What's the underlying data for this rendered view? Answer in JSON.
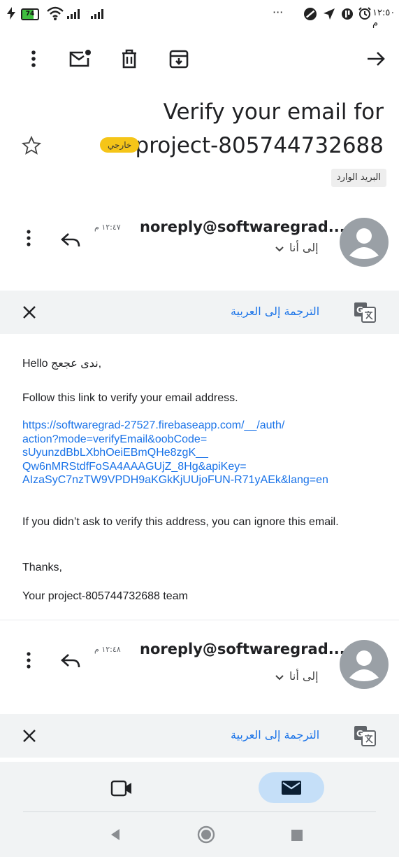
{
  "status_bar": {
    "battery": "74",
    "time": "١٢:٥٠ م",
    "dots": "···"
  },
  "toolbar": {
    "icons": [
      "more-vert-icon",
      "mark-unread-icon",
      "delete-icon",
      "archive-icon",
      "forward-arrow-icon"
    ]
  },
  "email": {
    "subject_line1": "Verify your email for",
    "subject_line2": "project-805744732688",
    "external_badge": "خارجي",
    "inbox_label": "البريد الوارد"
  },
  "messages": [
    {
      "sender": "noreply@softwaregrad...",
      "time": "١٢:٤٧ م",
      "to": "إلى أنا",
      "translate_label": "الترجمة إلى العربية"
    },
    {
      "sender": "noreply@softwaregrad...",
      "time": "١٢:٤٨ م",
      "to": "إلى أنا",
      "translate_label": "الترجمة إلى العربية"
    }
  ],
  "body": {
    "greeting": "Hello ندى عجعج,",
    "instruction": "Follow this link to verify your email address.",
    "link": "https://softwaregrad-27527.firebaseapp.com/__/auth/action?mode=verifyEmail&oobCode=sUyunzdBbLXbhOeiEBmQHe8zgK__Qw6nMRStdfFoSA4AAAGUjZ_8Hg&apiKey=AIzaSyC7nzTW9VPDH9aKGkKjUUjoFUN-R71yAEk&lang=en",
    "link_lines": [
      "https://softwaregrad-27527.firebaseapp.com/__/auth/",
      "action?mode=verifyEmail&oobCode=",
      "sUyunzdBbLXbhOeiEBmQHe8zgK__",
      "Qw6nMRStdfFoSA4AAAGUjZ_8Hg&apiKey=",
      "AIzaSyC7nzTW9VPDH9aKGkKjUUjoFUN-R71yAEk&lang=en"
    ],
    "ignore_note": "If you didn’t ask to verify this address, you can ignore this email.",
    "thanks": "Thanks,",
    "signature": "Your project-805744732688 team"
  },
  "colors": {
    "accent": "#1a73e8",
    "badge": "#f5c518",
    "avatar": "#9aa0a6",
    "translate_bar": "#f1f3f4",
    "nav_pill": "#c5dff8"
  }
}
